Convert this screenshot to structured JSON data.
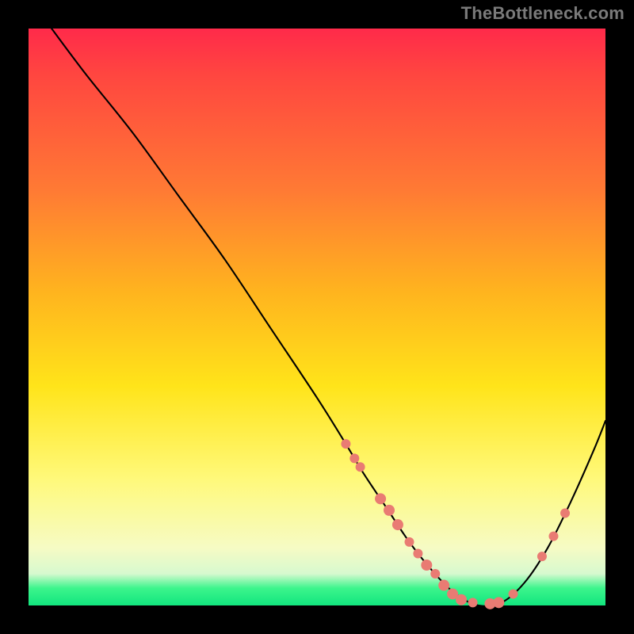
{
  "attribution": "TheBottleneck.com",
  "chart_data": {
    "type": "line",
    "title": "",
    "xlabel": "",
    "ylabel": "",
    "xlim": [
      0,
      100
    ],
    "ylim": [
      0,
      100
    ],
    "series": [
      {
        "name": "bottleneck-curve",
        "x": [
          4,
          10,
          18,
          26,
          34,
          42,
          50,
          55,
          58,
          62,
          66,
          70,
          74,
          78,
          82,
          86,
          90,
          94,
          98,
          100
        ],
        "y": [
          100,
          92,
          82,
          71,
          60,
          48,
          36,
          28,
          23,
          17,
          11,
          6,
          2,
          0,
          0.5,
          4,
          10,
          18,
          27,
          32
        ]
      }
    ],
    "markers": {
      "name": "highlighted-points",
      "points": [
        {
          "x": 55,
          "y": 28,
          "r": 6
        },
        {
          "x": 56.5,
          "y": 25.5,
          "r": 6
        },
        {
          "x": 57.5,
          "y": 24,
          "r": 6
        },
        {
          "x": 61,
          "y": 18.5,
          "r": 7
        },
        {
          "x": 62.5,
          "y": 16.5,
          "r": 7
        },
        {
          "x": 64,
          "y": 14,
          "r": 7
        },
        {
          "x": 66,
          "y": 11,
          "r": 6
        },
        {
          "x": 67.5,
          "y": 9,
          "r": 6
        },
        {
          "x": 69,
          "y": 7,
          "r": 7
        },
        {
          "x": 70.5,
          "y": 5.5,
          "r": 6
        },
        {
          "x": 72,
          "y": 3.5,
          "r": 7
        },
        {
          "x": 73.5,
          "y": 2,
          "r": 7
        },
        {
          "x": 75,
          "y": 1,
          "r": 7
        },
        {
          "x": 77,
          "y": 0.5,
          "r": 6
        },
        {
          "x": 80,
          "y": 0.3,
          "r": 7
        },
        {
          "x": 81.5,
          "y": 0.5,
          "r": 7
        },
        {
          "x": 84,
          "y": 2,
          "r": 6
        },
        {
          "x": 89,
          "y": 8.5,
          "r": 6
        },
        {
          "x": 91,
          "y": 12,
          "r": 6
        },
        {
          "x": 93,
          "y": 16,
          "r": 6
        }
      ]
    },
    "gradient_colors": {
      "top": "#ff2a4a",
      "mid_upper": "#ff7a34",
      "mid": "#ffe41a",
      "mid_lower": "#f6fbc4",
      "bottom": "#12e57e"
    }
  }
}
